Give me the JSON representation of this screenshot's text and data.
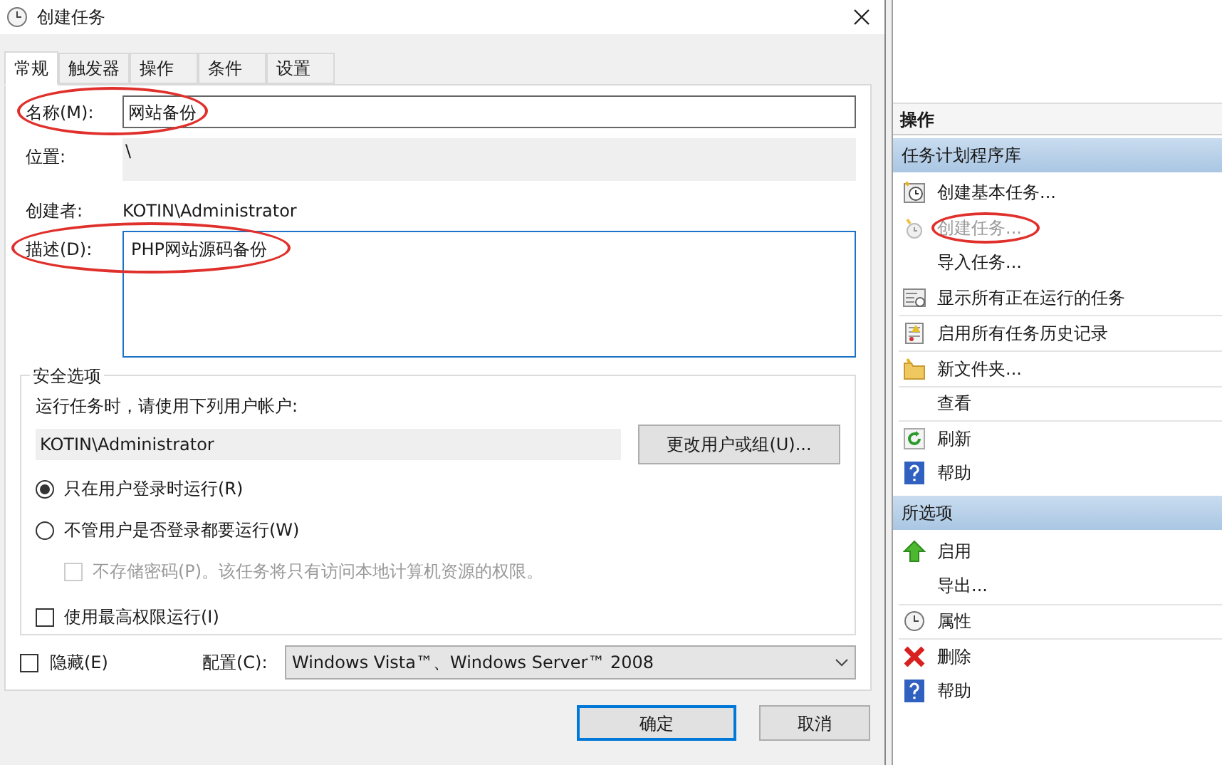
{
  "window": {
    "title": "创建任务"
  },
  "tabs": [
    {
      "label": "常规",
      "selected": true
    },
    {
      "label": "触发器",
      "selected": false
    },
    {
      "label": "操作",
      "selected": false
    },
    {
      "label": "条件",
      "selected": false
    },
    {
      "label": "设置",
      "selected": false
    }
  ],
  "general": {
    "name": {
      "label": "名称(M):",
      "value": "网站备份",
      "circled": true
    },
    "location": {
      "label": "位置:",
      "value": "\\"
    },
    "author": {
      "label": "创建者:",
      "value": "KOTIN\\Administrator"
    },
    "description": {
      "label": "描述(D):",
      "value": "PHP网站源码备份",
      "circled": true
    }
  },
  "security": {
    "title": "安全选项",
    "prompt": "运行任务时，请使用下列用户帐户:",
    "account": "KOTIN\\Administrator",
    "change_button": "更改用户或组(U)...",
    "options": [
      {
        "kind": "radio",
        "label": "只在用户登录时运行(R)",
        "selected": true,
        "disabled": false
      },
      {
        "kind": "radio",
        "label": "不管用户是否登录都要运行(W)",
        "selected": false,
        "disabled": false
      },
      {
        "kind": "checkbox",
        "label": "不存储密码(P)。该任务将只有访问本地计算机资源的权限。",
        "checked": false,
        "disabled": true
      },
      {
        "kind": "checkbox",
        "label": "使用最高权限运行(I)",
        "checked": false,
        "disabled": false
      }
    ]
  },
  "hidden": {
    "label": "隐藏(E)",
    "checked": false
  },
  "config": {
    "label": "配置(C):",
    "value": "Windows Vista™、Windows Server™ 2008"
  },
  "buttons": [
    {
      "label": "确定",
      "default": true
    },
    {
      "label": "取消",
      "default": false
    }
  ],
  "actions_pane": {
    "title": "操作",
    "groups": [
      {
        "title": "任务计划程序库",
        "items": [
          {
            "label": "创建基本任务...",
            "disabled": false,
            "circled": false
          },
          {
            "label": "创建任务...",
            "disabled": true,
            "circled": true
          },
          {
            "label": "导入任务...",
            "disabled": false,
            "circled": false
          },
          {
            "label": "显示所有正在运行的任务",
            "disabled": false,
            "circled": false
          },
          {
            "label": "启用所有任务历史记录",
            "disabled": false,
            "circled": false
          },
          {
            "label": "新文件夹...",
            "disabled": false,
            "circled": false
          },
          {
            "label": "查看",
            "disabled": false,
            "circled": false
          },
          {
            "label": "刷新",
            "disabled": false,
            "circled": false
          },
          {
            "label": "帮助",
            "disabled": false,
            "circled": false
          }
        ]
      },
      {
        "title": "所选项",
        "items": [
          {
            "label": "启用",
            "disabled": false,
            "circled": false
          },
          {
            "label": "导出...",
            "disabled": false,
            "circled": false
          },
          {
            "label": "属性",
            "disabled": false,
            "circled": false
          },
          {
            "label": "删除",
            "disabled": false,
            "circled": false
          },
          {
            "label": "帮助",
            "disabled": false,
            "circled": false
          }
        ]
      }
    ]
  }
}
